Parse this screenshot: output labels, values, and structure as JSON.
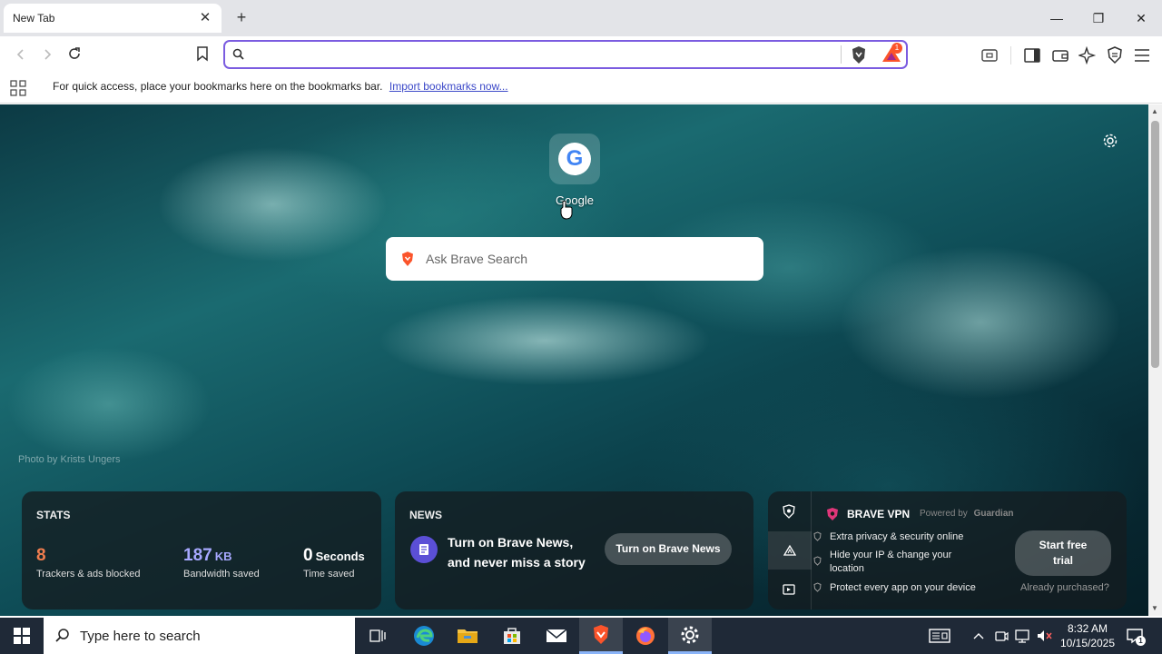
{
  "tab": {
    "title": "New Tab",
    "close": "✕",
    "new_tab": "+"
  },
  "window": {
    "minimize": "—",
    "restore": "❐",
    "close": "✕"
  },
  "address": {
    "value": "",
    "shields_count": "1"
  },
  "bookmarks_bar": {
    "text": "For quick access, place your bookmarks here on the bookmarks bar.",
    "link": "Import bookmarks now..."
  },
  "background": {
    "credit": "Photo by Krists Ungers"
  },
  "top_site": {
    "label": "Google",
    "letter": "G"
  },
  "search": {
    "placeholder": "Ask Brave Search"
  },
  "stats": {
    "heading": "STATS",
    "trackers": {
      "value": "8",
      "label": "Trackers & ads blocked",
      "color": "#f07d4e"
    },
    "bandwidth": {
      "value": "187",
      "unit": "KB",
      "label": "Bandwidth saved",
      "color": "#a7a8ff"
    },
    "time": {
      "value": "0",
      "unit": "Seconds",
      "label": "Time saved"
    }
  },
  "news": {
    "heading": "NEWS",
    "line1": "Turn on Brave News,",
    "line2": "and never miss a story",
    "button": "Turn on Brave News"
  },
  "vpn": {
    "title": "BRAVE VPN",
    "powered": "Powered by",
    "partner": "Guardian",
    "features": [
      "Extra privacy & security online",
      "Hide your IP & change your location",
      "Protect every app on your device"
    ],
    "cta_line1": "Start free",
    "cta_line2": "trial",
    "already": "Already purchased?"
  },
  "taskbar": {
    "search_placeholder": "Type here to search",
    "time": "8:32 AM",
    "date": "10/15/2025",
    "notifications": "1"
  },
  "colors": {
    "accent": "#7b5ce0",
    "brave_orange": "#fb542b",
    "taskbar": "#1f2937"
  }
}
